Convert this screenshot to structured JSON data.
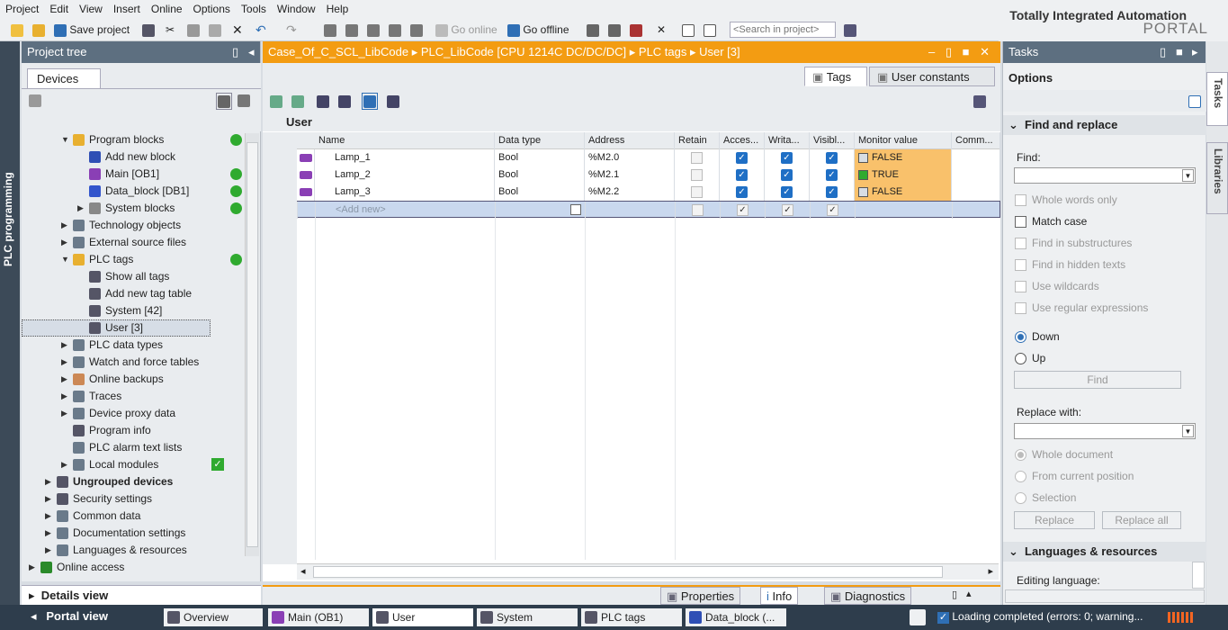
{
  "menu": [
    "Project",
    "Edit",
    "View",
    "Insert",
    "Online",
    "Options",
    "Tools",
    "Window",
    "Help"
  ],
  "toolbar": {
    "save": "Save project",
    "go_online": "Go online",
    "go_offline": "Go offline",
    "search_placeholder": "<Search in project>"
  },
  "brand": {
    "line1": "Totally Integrated Automation",
    "line2": "PORTAL"
  },
  "vertical_tab": "PLC programming",
  "project_tree": {
    "title": "Project tree",
    "tab": "Devices",
    "items": [
      {
        "label": "Program blocks",
        "level": 2,
        "tri": "down",
        "dot": true
      },
      {
        "label": "Add new block",
        "level": 3
      },
      {
        "label": "Main [OB1]",
        "level": 3,
        "dot": true
      },
      {
        "label": "Data_block [DB1]",
        "level": 3,
        "dot": true
      },
      {
        "label": "System blocks",
        "level": 3,
        "tri": "right",
        "dot": true
      },
      {
        "label": "Technology objects",
        "level": 2,
        "tri": "right"
      },
      {
        "label": "External source files",
        "level": 2,
        "tri": "right"
      },
      {
        "label": "PLC tags",
        "level": 2,
        "tri": "down",
        "dot": true
      },
      {
        "label": "Show all tags",
        "level": 3
      },
      {
        "label": "Add new tag table",
        "level": 3
      },
      {
        "label": "System [42]",
        "level": 3
      },
      {
        "label": "User [3]",
        "level": 3,
        "selected": true
      },
      {
        "label": "PLC data types",
        "level": 2,
        "tri": "right"
      },
      {
        "label": "Watch and force tables",
        "level": 2,
        "tri": "right"
      },
      {
        "label": "Online backups",
        "level": 2,
        "tri": "right"
      },
      {
        "label": "Traces",
        "level": 2,
        "tri": "right"
      },
      {
        "label": "Device proxy data",
        "level": 2,
        "tri": "right"
      },
      {
        "label": "Program info",
        "level": 2
      },
      {
        "label": "PLC alarm text lists",
        "level": 2
      },
      {
        "label": "Local modules",
        "level": 2,
        "tri": "right",
        "check": true
      },
      {
        "label": "Ungrouped devices",
        "level": 1,
        "tri": "right"
      },
      {
        "label": "Security settings",
        "level": 1,
        "tri": "right"
      },
      {
        "label": "Common data",
        "level": 1,
        "tri": "right"
      },
      {
        "label": "Documentation settings",
        "level": 1,
        "tri": "right"
      },
      {
        "label": "Languages & resources",
        "level": 1,
        "tri": "right"
      },
      {
        "label": "Online access",
        "level": 0,
        "tri": "right"
      }
    ],
    "details": "Details view"
  },
  "editor": {
    "breadcrumb": "Case_Of_C_SCL_LibCode  ▸  PLC_LibCode [CPU 1214C DC/DC/DC]  ▸  PLC tags  ▸  User [3]",
    "tabs": [
      "Tags",
      "User constants"
    ],
    "table_title": "User",
    "columns": [
      "Name",
      "Data type",
      "Address",
      "Retain",
      "Acces...",
      "Writa...",
      "Visibl...",
      "Monitor value",
      "Comm..."
    ],
    "rows": [
      {
        "n": "1",
        "name": "Lamp_1",
        "type": "Bool",
        "addr": "%M2.0",
        "mon": "FALSE"
      },
      {
        "n": "2",
        "name": "Lamp_2",
        "type": "Bool",
        "addr": "%M2.1",
        "mon": "TRUE"
      },
      {
        "n": "3",
        "name": "Lamp_3",
        "type": "Bool",
        "addr": "%M2.2",
        "mon": "FALSE"
      }
    ],
    "add_row": {
      "n": "4",
      "name": "<Add new>"
    },
    "bottom_tabs": [
      "Properties",
      "Info",
      "Diagnostics"
    ]
  },
  "tasks": {
    "title": "Tasks",
    "options": "Options",
    "find_replace": "Find and replace",
    "find_label": "Find:",
    "checks": [
      "Whole words only",
      "Match case",
      "Find in substructures",
      "Find in hidden texts",
      "Use wildcards",
      "Use regular expressions"
    ],
    "dir": [
      "Down",
      "Up"
    ],
    "find_btn": "Find",
    "replace_label": "Replace with:",
    "scope": [
      "Whole document",
      "From current position",
      "Selection"
    ],
    "replace_btn": "Replace",
    "replace_all_btn": "Replace all",
    "lang_res": "Languages & resources",
    "editing_lang": "Editing language:"
  },
  "side_tabs": [
    "Tasks",
    "Libraries"
  ],
  "status": {
    "portal": "Portal view",
    "items": [
      "Overview",
      "Main (OB1)",
      "User",
      "System",
      "PLC tags",
      "Data_block (..."
    ],
    "message": "Loading completed (errors: 0; warning..."
  }
}
